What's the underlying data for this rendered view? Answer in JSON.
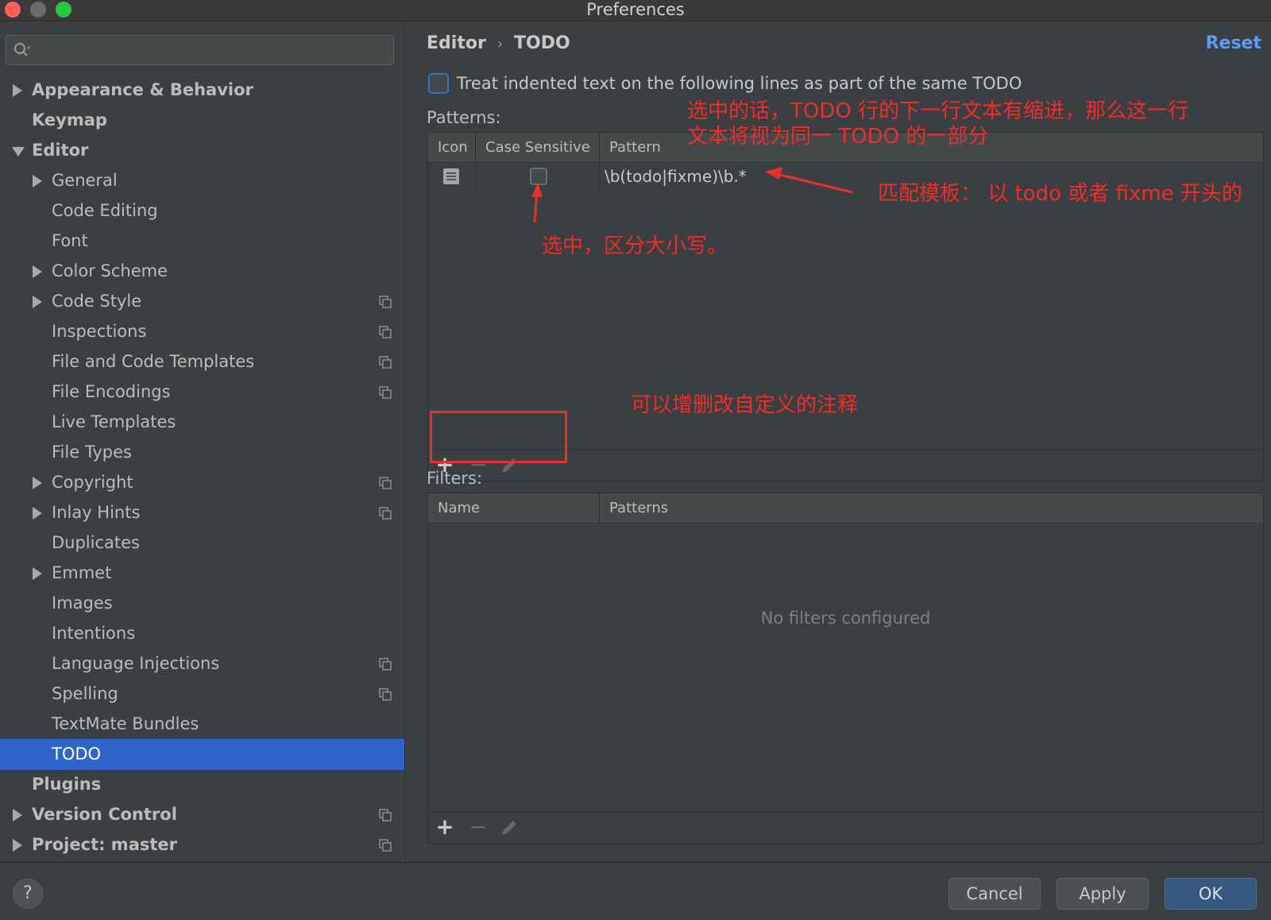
{
  "window": {
    "title": "Preferences"
  },
  "sidebar": {
    "search": {
      "placeholder": ""
    },
    "items": [
      {
        "label": "Appearance & Behavior"
      },
      {
        "label": "Keymap"
      },
      {
        "label": "Editor"
      },
      {
        "label": "General"
      },
      {
        "label": "Code Editing"
      },
      {
        "label": "Font"
      },
      {
        "label": "Color Scheme"
      },
      {
        "label": "Code Style"
      },
      {
        "label": "Inspections"
      },
      {
        "label": "File and Code Templates"
      },
      {
        "label": "File Encodings"
      },
      {
        "label": "Live Templates"
      },
      {
        "label": "File Types"
      },
      {
        "label": "Copyright"
      },
      {
        "label": "Inlay Hints"
      },
      {
        "label": "Duplicates"
      },
      {
        "label": "Emmet"
      },
      {
        "label": "Images"
      },
      {
        "label": "Intentions"
      },
      {
        "label": "Language Injections"
      },
      {
        "label": "Spelling"
      },
      {
        "label": "TextMate Bundles"
      },
      {
        "label": "TODO"
      },
      {
        "label": "Plugins"
      },
      {
        "label": "Version Control"
      },
      {
        "label": "Project: master"
      }
    ]
  },
  "header": {
    "breadcrumb_parent": "Editor",
    "breadcrumb_sep": "›",
    "breadcrumb_current": "TODO",
    "reset_label": "Reset"
  },
  "settings": {
    "indent_checkbox_label": "Treat indented text on the following lines as part of the same TODO",
    "patterns_label": "Patterns:",
    "patterns_columns": {
      "icon": "Icon",
      "case_sensitive": "Case Sensitive",
      "pattern": "Pattern"
    },
    "patterns_rows": [
      {
        "pattern": "\\b(todo|fixme)\\b.*"
      }
    ],
    "filters_label": "Filters:",
    "filters_columns": {
      "name": "Name",
      "patterns": "Patterns"
    },
    "filters_empty": "No filters configured"
  },
  "toolbar": {
    "add": "+",
    "remove": "−"
  },
  "annotations": {
    "indent_note_line1": "选中的话，TODO 行的下一行文本有缩进，那么这一行",
    "indent_note_line2": "文本将视为同一 TODO 的一部分",
    "pattern_note": "匹配模板： 以 todo 或者 fixme 开头的",
    "case_note": "选中，区分大小写。",
    "toolbar_note": "可以增删改自定义的注释",
    "color": "#f02c2c"
  },
  "footer": {
    "help_label": "?",
    "cancel_label": "Cancel",
    "apply_label": "Apply",
    "ok_label": "OK"
  }
}
